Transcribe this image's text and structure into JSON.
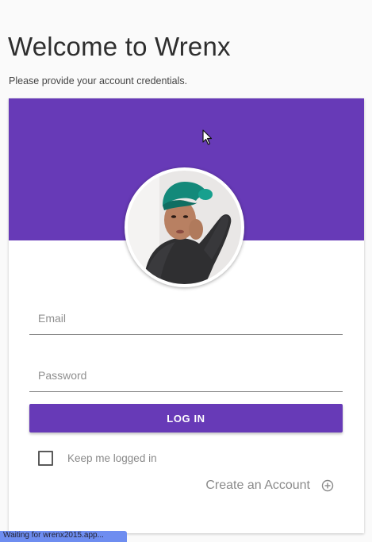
{
  "page": {
    "title": "Welcome to Wrenx",
    "subtitle": "Please provide your account credentials."
  },
  "colors": {
    "accent": "#673ab7",
    "background": "#fafafa",
    "card": "#ffffff",
    "muted_text": "#8a8a8a"
  },
  "avatar": {
    "icon": "user-photo"
  },
  "form": {
    "email_placeholder": "Email",
    "email_value": "",
    "password_placeholder": "Password",
    "password_value": "",
    "login_label": "LOG IN",
    "keep_logged_in_label": "Keep me logged in",
    "keep_logged_in_checked": false,
    "create_account_label": "Create an Account",
    "create_account_icon": "plus-circle-icon"
  },
  "status_bar": {
    "text": "Waiting for wrenx2015.app..."
  }
}
